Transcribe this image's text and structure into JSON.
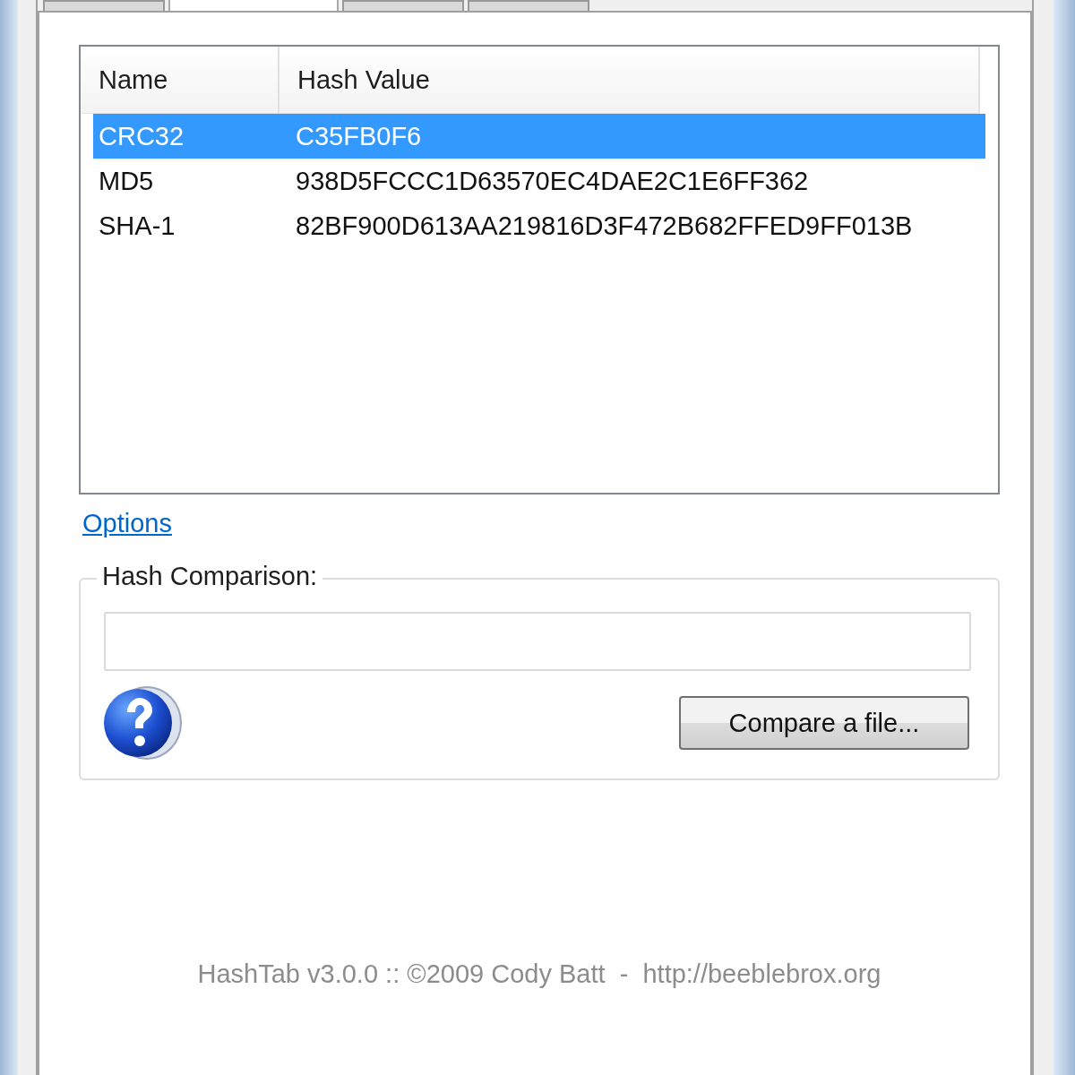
{
  "tabs": [
    {
      "selected": false
    },
    {
      "selected": true
    },
    {
      "selected": false
    },
    {
      "selected": false
    }
  ],
  "hash_list": {
    "columns": [
      "Name",
      "Hash Value"
    ],
    "rows": [
      {
        "name": "CRC32",
        "hash": "C35FB0F6",
        "selected": true
      },
      {
        "name": "MD5",
        "hash": "938D5FCCC1D63570EC4DAE2C1E6FF362",
        "selected": false
      },
      {
        "name": "SHA-1",
        "hash": "82BF900D613AA219816D3F472B682FFED9FF013B",
        "selected": false
      }
    ]
  },
  "options_link": "Options",
  "hash_comparison": {
    "legend": "Hash Comparison:",
    "button": "Compare a file..."
  },
  "footer": "HashTab v3.0.0 :: ©2009 Cody Batt  -  http://beeblebrox.org"
}
